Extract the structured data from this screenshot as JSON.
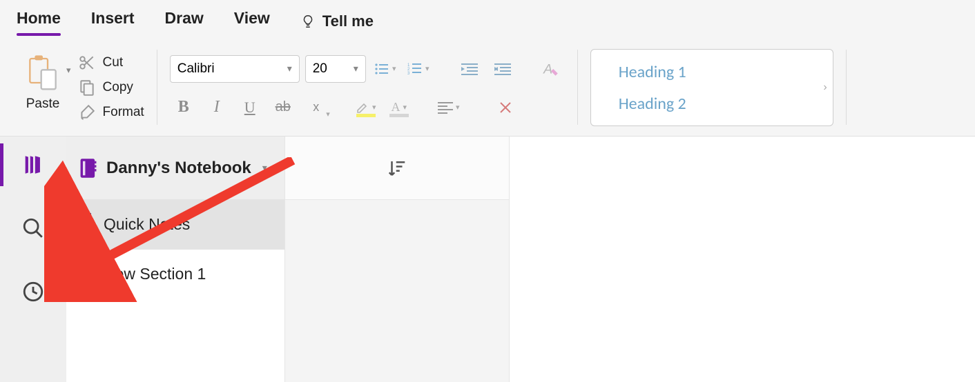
{
  "tabs": {
    "home": "Home",
    "insert": "Insert",
    "draw": "Draw",
    "view": "View",
    "tellme": "Tell me"
  },
  "clipboard": {
    "paste": "Paste",
    "cut": "Cut",
    "copy": "Copy",
    "format": "Format"
  },
  "font": {
    "name": "Calibri",
    "size": "20"
  },
  "styles": {
    "h1": "Heading 1",
    "h2": "Heading 2"
  },
  "notebook": {
    "title": "Danny's Notebook"
  },
  "sections": [
    {
      "label": "Quick Notes",
      "color": "#2b579a",
      "selected": true
    },
    {
      "label": "New Section 1",
      "color": "#2b579a",
      "selected": false
    }
  ],
  "colors": {
    "accent": "#7719AA"
  }
}
